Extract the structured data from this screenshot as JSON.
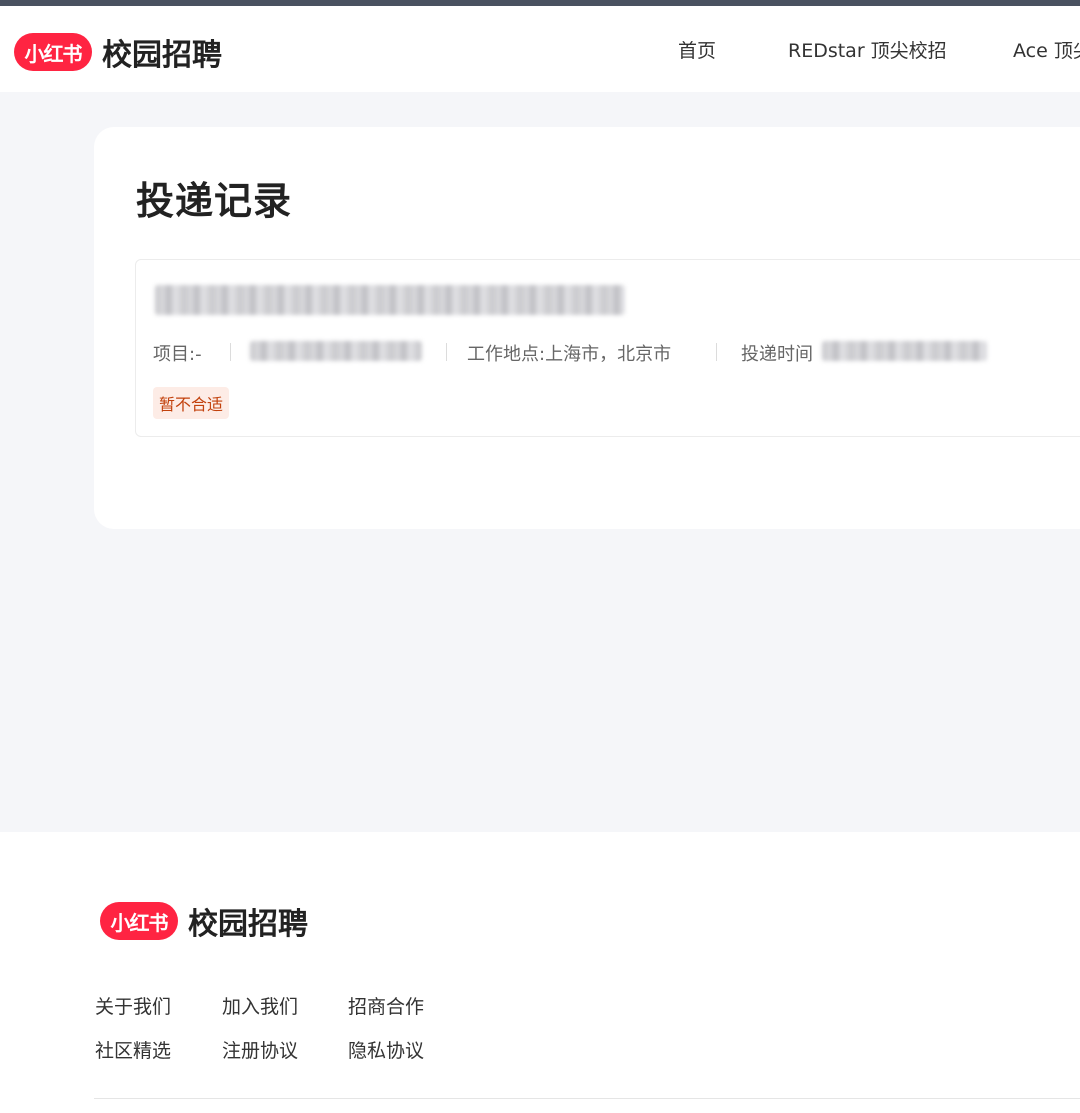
{
  "header": {
    "logo": {
      "brand": "小红书",
      "text": "校园招聘"
    },
    "nav": [
      {
        "label": "首页"
      },
      {
        "label": "REDstar 顶尖校招"
      },
      {
        "label": "Ace 顶尖"
      }
    ]
  },
  "main": {
    "title": "投递记录",
    "record": {
      "project_label": "项目:-",
      "location_label": "工作地点:上海市，北京市",
      "time_label": "投递时间",
      "status": "暂不合适",
      "redacted_note": "position name, project detail and submission time are pixelated in the original"
    }
  },
  "footer": {
    "logo": {
      "brand": "小红书",
      "text": "校园招聘"
    },
    "links": [
      {
        "label": "关于我们"
      },
      {
        "label": "加入我们"
      },
      {
        "label": "招商合作"
      },
      {
        "label": "社区精选"
      },
      {
        "label": "注册协议"
      },
      {
        "label": "隐私协议"
      }
    ]
  },
  "colors": {
    "brand": "#ff2442",
    "page_bg": "#f5f6f9",
    "status_text": "#c2410c",
    "status_bg": "#fdece6"
  }
}
